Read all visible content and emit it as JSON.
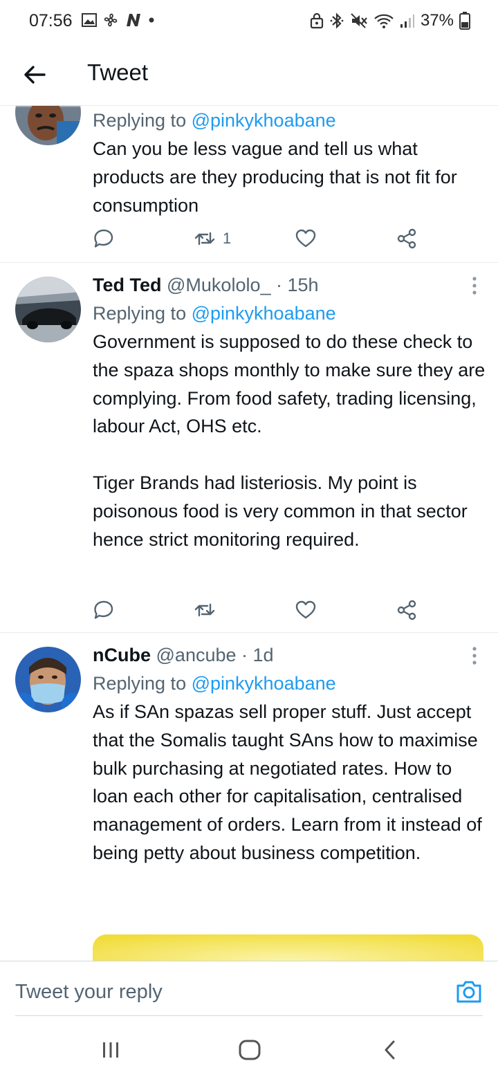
{
  "status_bar": {
    "time": "07:56",
    "battery": "37%",
    "left_icons": [
      "image-icon",
      "fan-icon",
      "n-app-icon",
      "dot-icon"
    ],
    "right_icons": [
      "lock-icon",
      "bluetooth-icon",
      "mute-icon",
      "wifi-icon",
      "signal-icon",
      "battery-icon"
    ]
  },
  "header": {
    "title": "Tweet",
    "back_icon": "arrow-left-icon"
  },
  "tweets": [
    {
      "name": "",
      "handle": "",
      "time": "",
      "replying_prefix": "Replying to ",
      "replying_to": "@pinkykhoabane",
      "text": "Can you be less vague and tell us what products are they producing that is not fit for consumption",
      "retweet_count": "1",
      "actions": [
        "reply-icon",
        "retweet-icon",
        "like-icon",
        "share-icon"
      ]
    },
    {
      "name": "Ted Ted",
      "handle": "@Mukololo_",
      "time": "· 15h",
      "replying_prefix": "Replying to ",
      "replying_to": "@pinkykhoabane",
      "text": "Government is supposed to do these check to the spaza shops monthly to make sure they are complying. From food safety, trading licensing, labour Act, OHS etc.\n\nTiger Brands had listeriosis. My point is poisonous food is very common in that sector hence strict monitoring required.",
      "retweet_count": "",
      "actions": [
        "reply-icon",
        "retweet-icon",
        "like-icon",
        "share-icon"
      ]
    },
    {
      "name": "nCube",
      "handle": "@ancube",
      "time": "· 1d",
      "replying_prefix": "Replying to ",
      "replying_to": "@pinkykhoabane",
      "text": "As if SAn spazas sell proper stuff. Just accept that the Somalis taught SAns how to maximise bulk purchasing at negotiated rates. How to loan each other for capitalisation, centralised management of orders. Learn from it instead of being petty about business competition.",
      "has_media": true
    }
  ],
  "reply_bar": {
    "placeholder": "Tweet your reply",
    "camera_icon": "camera-icon"
  },
  "nav_bar": {
    "icons": [
      "recents-icon",
      "home-icon",
      "back-icon"
    ]
  },
  "colors": {
    "accent": "#1d9bf0",
    "text_primary": "#0f1419",
    "text_secondary": "#536471",
    "divider": "#e6ecf0"
  }
}
